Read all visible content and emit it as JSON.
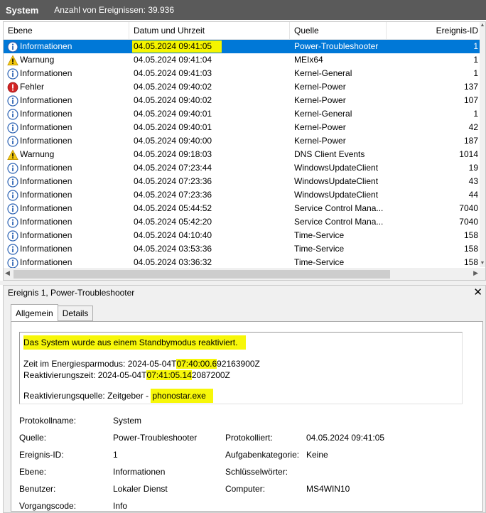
{
  "header": {
    "title": "System",
    "event_count": "Anzahl von Ereignissen: 39.936"
  },
  "table": {
    "columns": [
      "Ebene",
      "Datum und Uhrzeit",
      "Quelle",
      "Ereignis-ID"
    ],
    "rows": [
      {
        "level": "Informationen",
        "icon": "info-icon",
        "datetime": "04.05.2024 09:41:05",
        "source": "Power-Troubleshooter",
        "id": "1"
      },
      {
        "level": "Warnung",
        "icon": "warning-icon",
        "datetime": "04.05.2024 09:41:04",
        "source": "MEIx64",
        "id": "1"
      },
      {
        "level": "Informationen",
        "icon": "info-icon",
        "datetime": "04.05.2024 09:41:03",
        "source": "Kernel-General",
        "id": "1"
      },
      {
        "level": "Fehler",
        "icon": "error-icon",
        "datetime": "04.05.2024 09:40:02",
        "source": "Kernel-Power",
        "id": "137"
      },
      {
        "level": "Informationen",
        "icon": "info-icon",
        "datetime": "04.05.2024 09:40:02",
        "source": "Kernel-Power",
        "id": "107"
      },
      {
        "level": "Informationen",
        "icon": "info-icon",
        "datetime": "04.05.2024 09:40:01",
        "source": "Kernel-General",
        "id": "1"
      },
      {
        "level": "Informationen",
        "icon": "info-icon",
        "datetime": "04.05.2024 09:40:01",
        "source": "Kernel-Power",
        "id": "42"
      },
      {
        "level": "Informationen",
        "icon": "info-icon",
        "datetime": "04.05.2024 09:40:00",
        "source": "Kernel-Power",
        "id": "187"
      },
      {
        "level": "Warnung",
        "icon": "warning-icon",
        "datetime": "04.05.2024 09:18:03",
        "source": "DNS Client Events",
        "id": "1014"
      },
      {
        "level": "Informationen",
        "icon": "info-icon",
        "datetime": "04.05.2024 07:23:44",
        "source": "WindowsUpdateClient",
        "id": "19"
      },
      {
        "level": "Informationen",
        "icon": "info-icon",
        "datetime": "04.05.2024 07:23:36",
        "source": "WindowsUpdateClient",
        "id": "43"
      },
      {
        "level": "Informationen",
        "icon": "info-icon",
        "datetime": "04.05.2024 07:23:36",
        "source": "WindowsUpdateClient",
        "id": "44"
      },
      {
        "level": "Informationen",
        "icon": "info-icon",
        "datetime": "04.05.2024 05:44:52",
        "source": "Service Control Mana...",
        "id": "7040"
      },
      {
        "level": "Informationen",
        "icon": "info-icon",
        "datetime": "04.05.2024 05:42:20",
        "source": "Service Control Mana...",
        "id": "7040"
      },
      {
        "level": "Informationen",
        "icon": "info-icon",
        "datetime": "04.05.2024 04:10:40",
        "source": "Time-Service",
        "id": "158"
      },
      {
        "level": "Informationen",
        "icon": "info-icon",
        "datetime": "04.05.2024 03:53:36",
        "source": "Time-Service",
        "id": "158"
      },
      {
        "level": "Informationen",
        "icon": "info-icon",
        "datetime": "04.05.2024 03:36:32",
        "source": "Time-Service",
        "id": "158"
      }
    ]
  },
  "details": {
    "title": "Ereignis 1, Power-Troubleshooter",
    "tabs": [
      "Allgemein",
      "Details"
    ],
    "message": {
      "line1": "Das System wurde aus einem Standbymodus reaktiviert.",
      "sleep_prefix": "Zeit im Energiesparmodus: 2024-05-04T",
      "sleep_hl": "07:40:00.6",
      "sleep_suffix": "92163900Z",
      "wake_prefix": "Reaktivierungszeit: 2024-05-04T",
      "wake_hl": "07:41:05.14",
      "wake_suffix": "2087200Z",
      "source_prefix": "Reaktivierungsquelle: Zeitgeber - ",
      "source_hl": "phonostar.exe"
    },
    "properties": {
      "log_name_label": "Protokollname:",
      "log_name": "System",
      "source_label": "Quelle:",
      "source": "Power-Troubleshooter",
      "logged_label": "Protokolliert:",
      "logged": "04.05.2024 09:41:05",
      "event_id_label": "Ereignis-ID:",
      "event_id": "1",
      "task_label": "Aufgabenkategorie:",
      "task": "Keine",
      "level_label": "Ebene:",
      "level": "Informationen",
      "keywords_label": "Schlüsselwörter:",
      "keywords": "",
      "user_label": "Benutzer:",
      "user": "Lokaler Dienst",
      "computer_label": "Computer:",
      "computer": "MS4WIN10",
      "opcode_label": "Vorgangscode:",
      "opcode": "Info"
    }
  },
  "colors": {
    "selection": "#0078d7",
    "highlight": "#f7f709",
    "header_bg": "#5a5a5a",
    "info": "#2e64b4",
    "warning": "#f2c80f",
    "error": "#d32424"
  }
}
